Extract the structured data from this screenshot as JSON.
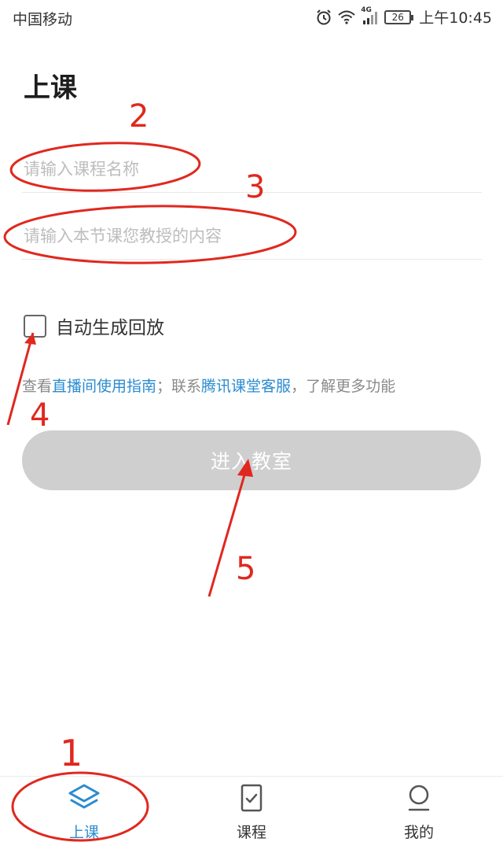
{
  "status_bar": {
    "carrier": "中国移动",
    "network": "4G",
    "battery": "26",
    "time": "上午10:45"
  },
  "page": {
    "title": "上课"
  },
  "form": {
    "course_name_placeholder": "请输入课程名称",
    "lesson_content_placeholder": "请输入本节课您教授的内容",
    "auto_replay_label": "自动生成回放",
    "auto_replay_checked": false
  },
  "help": {
    "prefix": "查看",
    "guide_link": "直播间使用指南",
    "middle": "；联系",
    "service_link": "腾讯课堂客服",
    "suffix": "，了解更多功能"
  },
  "enter_button": {
    "label": "进入教室"
  },
  "tabs": [
    {
      "label": "上课",
      "icon": "layers-icon",
      "active": true
    },
    {
      "label": "课程",
      "icon": "checklist-icon",
      "active": false
    },
    {
      "label": "我的",
      "icon": "profile-icon",
      "active": false
    }
  ],
  "annotations": [
    "1",
    "2",
    "3",
    "4",
    "5"
  ],
  "colors": {
    "accent": "#2a8bd0",
    "annotation": "#e0281e",
    "button_disabled": "#cfcfcf"
  }
}
